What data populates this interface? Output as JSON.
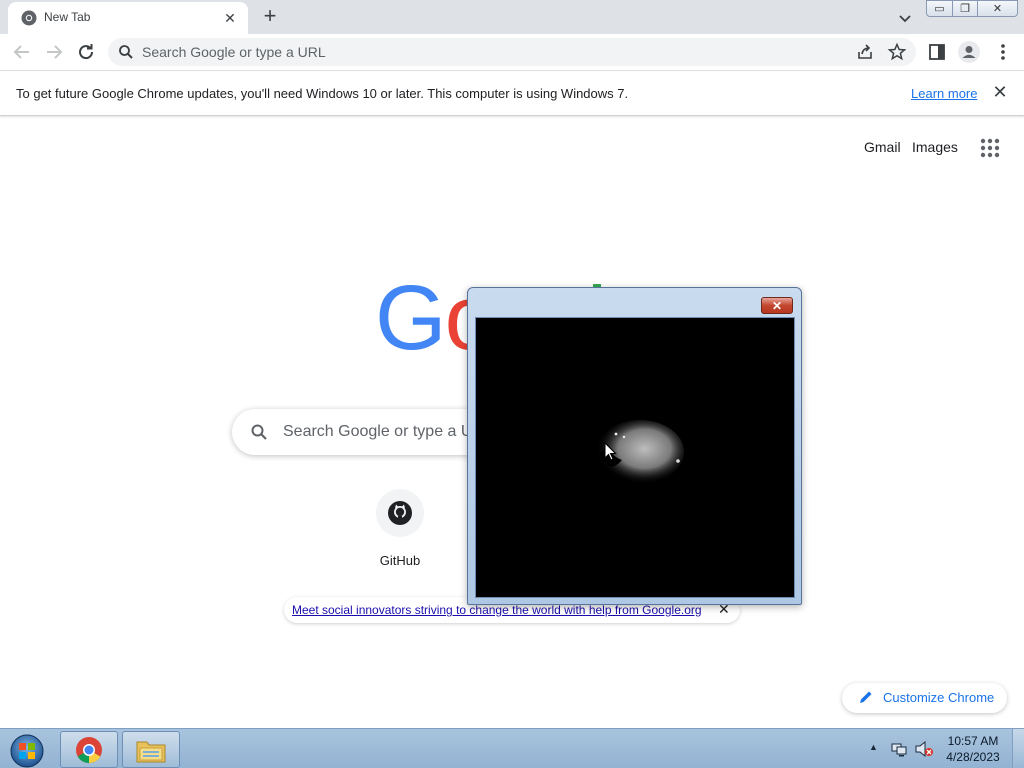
{
  "tab": {
    "title": "New Tab",
    "icon": "chrome-favicon",
    "close": "✕"
  },
  "newtab": {
    "label": "+"
  },
  "omnibox": {
    "placeholder": "Search Google or type a URL"
  },
  "infobar": {
    "message": "To get future Google Chrome updates, you'll need Windows 10 or later. This computer is using Windows 7.",
    "link": "Learn more",
    "close": "✕"
  },
  "ntp": {
    "gmail": "Gmail",
    "images": "Images",
    "search_placeholder": "Search Google or type a URL",
    "shortcut_label": "GitHub",
    "promo": "Meet social innovators striving to change the world with help from Google.org",
    "promo_close": "✕",
    "customize": "Customize Chrome"
  },
  "logo": {
    "visible_letters": [
      "G",
      "o"
    ],
    "colors": [
      "#4285f4",
      "#ea4335",
      "#34a853"
    ]
  },
  "popup": {
    "close_glyph": "✕"
  },
  "window_controls": {
    "minimize": "▭",
    "maximize": "❐",
    "close": "✕"
  },
  "taskbar": {
    "time": "10:57 AM",
    "date": "4/28/2023",
    "tray_arrow": "▲",
    "pinned": [
      "chrome-icon",
      "file-explorer-icon"
    ]
  },
  "colors": {
    "accent": "#1a73e8",
    "tabstrip": "#dee1e6",
    "taskbar": "#a8c3dd"
  }
}
